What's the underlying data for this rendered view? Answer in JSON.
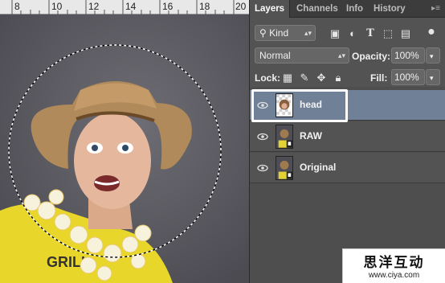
{
  "ruler": {
    "labels": [
      "8",
      "10",
      "12",
      "14",
      "16",
      "18",
      "20"
    ]
  },
  "panel": {
    "tabs": [
      "Layers",
      "Channels",
      "Info",
      "History"
    ],
    "filter_kind": "Kind",
    "blend_mode": "Normal",
    "opacity_label": "Opacity:",
    "opacity_value": "100%",
    "lock_label": "Lock:",
    "fill_label": "Fill:",
    "fill_value": "100%"
  },
  "layers": [
    {
      "name": "head",
      "selected": true
    },
    {
      "name": "RAW",
      "selected": false
    },
    {
      "name": "Original",
      "selected": false
    }
  ],
  "watermark": {
    "text": "思洋互动",
    "url": "www.ciya.com"
  },
  "colors": {
    "selected_layer": "#6f8097",
    "panel_bg": "#535353",
    "canvas_bg": "#56565a"
  }
}
